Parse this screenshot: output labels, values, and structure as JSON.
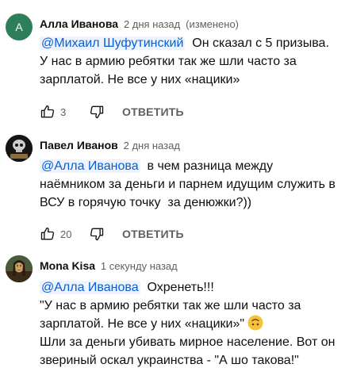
{
  "comments": [
    {
      "avatar_letter": "А",
      "avatar_color": "#2e7d5b",
      "author": "Алла Иванова",
      "time": "2 дня назад",
      "edited": "(изменено)",
      "mention": "@Михаил Шуфутинский",
      "text": "Он сказал с 5 призыва.  У нас в армию ребятки так же шли часто за зарплатой. Не все у них «нацики»",
      "likes": "3",
      "reply_label": "ОТВЕТИТЬ"
    },
    {
      "author": "Павел Иванов",
      "time": "2 дня назад",
      "mention": "@Алла Иванова",
      "text": "в чем разница между наёмником за деньги и парнем идущим служить в ВСУ в горячую точку  за денюжки?))",
      "likes": "20",
      "reply_label": "ОТВЕТИТЬ"
    },
    {
      "author": "Mona Kisa",
      "time": "1 секунду назад",
      "mention": "@Алла Иванова",
      "text_line1": "Охренеть!!!",
      "text_quote": "\"У нас в армию ребятки так же шли часто за зарплатой. Не все у них «нацики»\"",
      "emoji_name": "upside-down-face-emoji",
      "text_rest": "Шли за деньги убивать мирное население. Вот он звериный оскал украинства - \"А шо такова!\""
    }
  ]
}
